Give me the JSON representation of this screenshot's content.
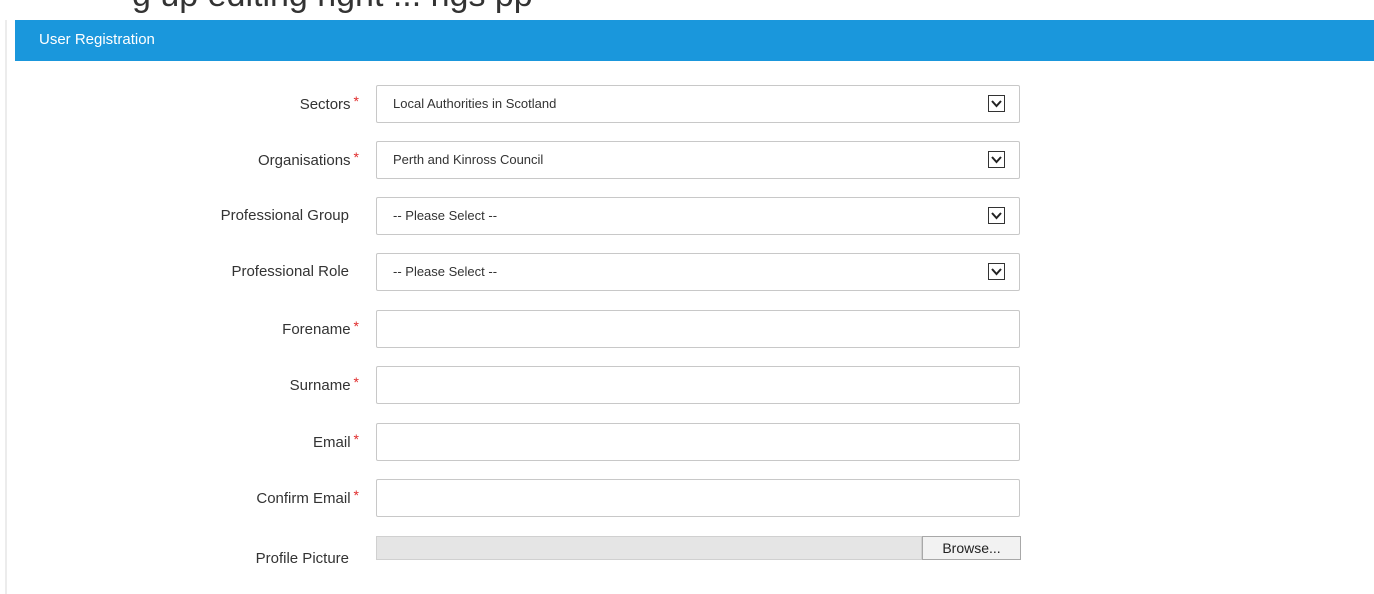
{
  "top_strip_text": "g up editing right               ...                                             ngs       pp",
  "header": {
    "title": "User Registration"
  },
  "form": {
    "required_marker": "*",
    "sectors": {
      "label": "Sectors",
      "value": "Local Authorities in Scotland"
    },
    "organisations": {
      "label": "Organisations",
      "value": "Perth and Kinross Council"
    },
    "professional_group": {
      "label": "Professional Group",
      "value": "-- Please Select --"
    },
    "professional_role": {
      "label": "Professional Role",
      "value": "-- Please Select --"
    },
    "forename": {
      "label": "Forename",
      "value": ""
    },
    "surname": {
      "label": "Surname",
      "value": ""
    },
    "email": {
      "label": "Email",
      "value": ""
    },
    "confirm_email": {
      "label": "Confirm Email",
      "value": ""
    },
    "profile_picture": {
      "label": "Profile Picture",
      "button": "Browse..."
    }
  },
  "colors": {
    "header_bg": "#1a97dc",
    "required": "#e02a2a"
  }
}
